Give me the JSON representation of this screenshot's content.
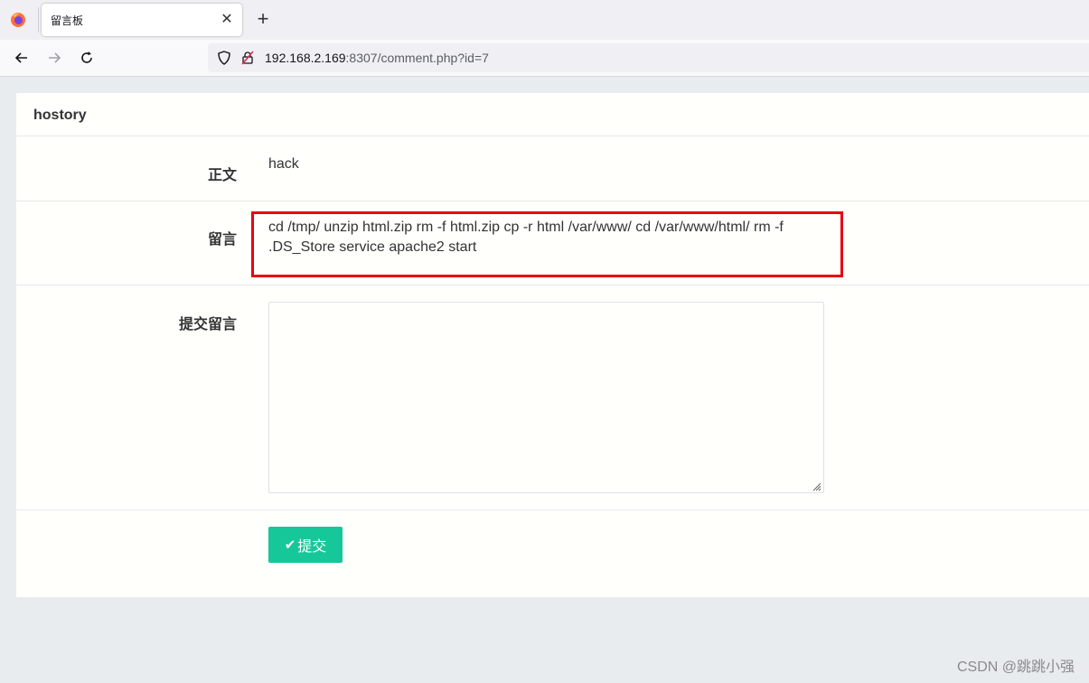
{
  "browser": {
    "tab_title": "留言板",
    "tab_close": "✕",
    "new_tab": "+",
    "url_host": "192.168.2.169",
    "url_rest": ":8307/comment.php?id=7"
  },
  "panel": {
    "title": "hostory"
  },
  "rows": {
    "body_label": "正文",
    "body_value": "hack",
    "comment_label": "留言",
    "comment_value": "cd /tmp/ unzip html.zip rm -f html.zip cp -r html /var/www/ cd /var/www/html/ rm -f .DS_Store service apache2 start",
    "submit_comment_label": "提交留言"
  },
  "textarea": {
    "value": ""
  },
  "submit_button": {
    "check": "✔",
    "label": "提交"
  },
  "watermark": "CSDN @跳跳小强",
  "colors": {
    "accent": "#16c79a",
    "highlight_border": "#e60012"
  }
}
